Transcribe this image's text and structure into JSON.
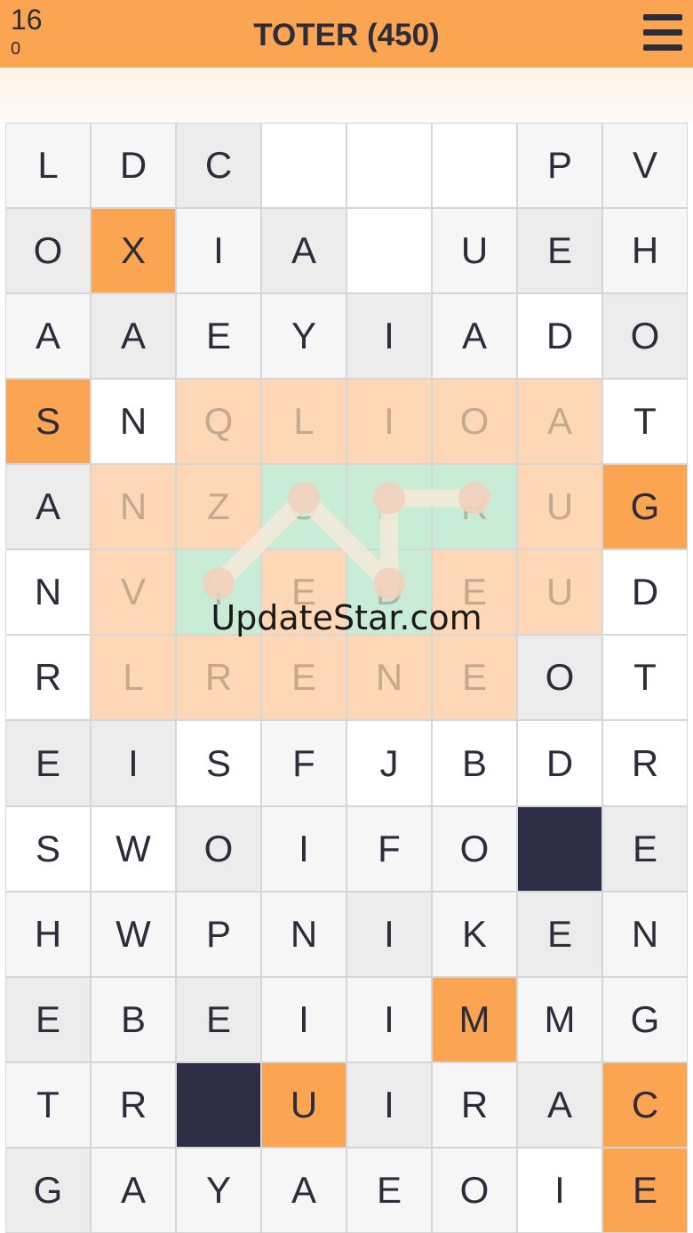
{
  "header": {
    "score": "16",
    "subscore": "0",
    "title": "TOTER (450)"
  },
  "colors": {
    "header": "#fba552",
    "selected": "#fba552",
    "found_word": "#fdd7b6",
    "current_path": "#c9ecd6",
    "blocked": "#2e2f47"
  },
  "icons": {
    "menu": "hamburger-menu-icon"
  },
  "grid": {
    "columns": 8,
    "rows": [
      {
        "cells": [
          {
            "letter": "L",
            "state": "light"
          },
          {
            "letter": "D",
            "state": "light"
          },
          {
            "letter": "C",
            "state": "gray"
          },
          {
            "letter": "",
            "state": "empty"
          },
          {
            "letter": "",
            "state": "empty"
          },
          {
            "letter": "",
            "state": "empty"
          },
          {
            "letter": "P",
            "state": "light"
          },
          {
            "letter": "V",
            "state": "light"
          }
        ]
      },
      {
        "cells": [
          {
            "letter": "O",
            "state": "gray"
          },
          {
            "letter": "X",
            "state": "orange"
          },
          {
            "letter": "I",
            "state": "light"
          },
          {
            "letter": "A",
            "state": "gray"
          },
          {
            "letter": "",
            "state": "empty"
          },
          {
            "letter": "U",
            "state": "light"
          },
          {
            "letter": "E",
            "state": "gray"
          },
          {
            "letter": "H",
            "state": "light"
          }
        ]
      },
      {
        "cells": [
          {
            "letter": "A",
            "state": "light"
          },
          {
            "letter": "A",
            "state": "gray"
          },
          {
            "letter": "E",
            "state": "light"
          },
          {
            "letter": "Y",
            "state": "light"
          },
          {
            "letter": "I",
            "state": "gray"
          },
          {
            "letter": "A",
            "state": "light"
          },
          {
            "letter": "D",
            "state": "white"
          },
          {
            "letter": "O",
            "state": "gray"
          }
        ]
      },
      {
        "cells": [
          {
            "letter": "S",
            "state": "orange"
          },
          {
            "letter": "N",
            "state": "white"
          },
          {
            "letter": "Q",
            "state": "peach"
          },
          {
            "letter": "L",
            "state": "peach"
          },
          {
            "letter": "I",
            "state": "peach"
          },
          {
            "letter": "O",
            "state": "peach"
          },
          {
            "letter": "A",
            "state": "peach"
          },
          {
            "letter": "T",
            "state": "white"
          }
        ]
      },
      {
        "cells": [
          {
            "letter": "A",
            "state": "gray"
          },
          {
            "letter": "N",
            "state": "peach"
          },
          {
            "letter": "Z",
            "state": "peach"
          },
          {
            "letter": "O",
            "state": "mint"
          },
          {
            "letter": "P",
            "state": "mint"
          },
          {
            "letter": "R",
            "state": "mint"
          },
          {
            "letter": "U",
            "state": "peach"
          },
          {
            "letter": "G",
            "state": "orange"
          }
        ]
      },
      {
        "cells": [
          {
            "letter": "N",
            "state": "white"
          },
          {
            "letter": "V",
            "state": "peach"
          },
          {
            "letter": "T",
            "state": "mint"
          },
          {
            "letter": "E",
            "state": "peach"
          },
          {
            "letter": "D",
            "state": "mint"
          },
          {
            "letter": "E",
            "state": "peach"
          },
          {
            "letter": "U",
            "state": "peach"
          },
          {
            "letter": "D",
            "state": "white"
          }
        ]
      },
      {
        "cells": [
          {
            "letter": "R",
            "state": "white"
          },
          {
            "letter": "L",
            "state": "peach"
          },
          {
            "letter": "R",
            "state": "peach"
          },
          {
            "letter": "E",
            "state": "peach"
          },
          {
            "letter": "N",
            "state": "peach"
          },
          {
            "letter": "E",
            "state": "peach"
          },
          {
            "letter": "O",
            "state": "gray"
          },
          {
            "letter": "T",
            "state": "white"
          }
        ]
      },
      {
        "cells": [
          {
            "letter": "E",
            "state": "gray"
          },
          {
            "letter": "I",
            "state": "gray"
          },
          {
            "letter": "S",
            "state": "white"
          },
          {
            "letter": "F",
            "state": "light"
          },
          {
            "letter": "J",
            "state": "white"
          },
          {
            "letter": "B",
            "state": "white"
          },
          {
            "letter": "D",
            "state": "white"
          },
          {
            "letter": "R",
            "state": "white"
          }
        ]
      },
      {
        "cells": [
          {
            "letter": "S",
            "state": "white"
          },
          {
            "letter": "W",
            "state": "white"
          },
          {
            "letter": "O",
            "state": "gray"
          },
          {
            "letter": "I",
            "state": "light"
          },
          {
            "letter": "F",
            "state": "light"
          },
          {
            "letter": "O",
            "state": "light"
          },
          {
            "letter": "",
            "state": "navy"
          },
          {
            "letter": "E",
            "state": "gray"
          }
        ]
      },
      {
        "cells": [
          {
            "letter": "H",
            "state": "light"
          },
          {
            "letter": "W",
            "state": "light"
          },
          {
            "letter": "P",
            "state": "light"
          },
          {
            "letter": "N",
            "state": "light"
          },
          {
            "letter": "I",
            "state": "gray"
          },
          {
            "letter": "K",
            "state": "light"
          },
          {
            "letter": "E",
            "state": "gray"
          },
          {
            "letter": "N",
            "state": "light"
          }
        ]
      },
      {
        "cells": [
          {
            "letter": "E",
            "state": "gray"
          },
          {
            "letter": "B",
            "state": "light"
          },
          {
            "letter": "E",
            "state": "gray"
          },
          {
            "letter": "I",
            "state": "light"
          },
          {
            "letter": "I",
            "state": "light"
          },
          {
            "letter": "M",
            "state": "orange"
          },
          {
            "letter": "M",
            "state": "light"
          },
          {
            "letter": "G",
            "state": "light"
          }
        ]
      },
      {
        "cells": [
          {
            "letter": "T",
            "state": "light"
          },
          {
            "letter": "R",
            "state": "light"
          },
          {
            "letter": "",
            "state": "navy"
          },
          {
            "letter": "U",
            "state": "orange"
          },
          {
            "letter": "I",
            "state": "gray"
          },
          {
            "letter": "R",
            "state": "light"
          },
          {
            "letter": "A",
            "state": "gray"
          },
          {
            "letter": "C",
            "state": "orange"
          }
        ]
      },
      {
        "cells": [
          {
            "letter": "G",
            "state": "gray"
          },
          {
            "letter": "A",
            "state": "light"
          },
          {
            "letter": "Y",
            "state": "light"
          },
          {
            "letter": "A",
            "state": "light"
          },
          {
            "letter": "E",
            "state": "light"
          },
          {
            "letter": "O",
            "state": "light"
          },
          {
            "letter": "I",
            "state": "white"
          },
          {
            "letter": "E",
            "state": "orange"
          }
        ]
      }
    ]
  },
  "selection_path": [
    {
      "row": 5,
      "col": 2
    },
    {
      "row": 4,
      "col": 3
    },
    {
      "row": 5,
      "col": 4
    },
    {
      "row": 4,
      "col": 4
    },
    {
      "row": 4,
      "col": 5
    }
  ],
  "watermark": "UpdateStar.com"
}
